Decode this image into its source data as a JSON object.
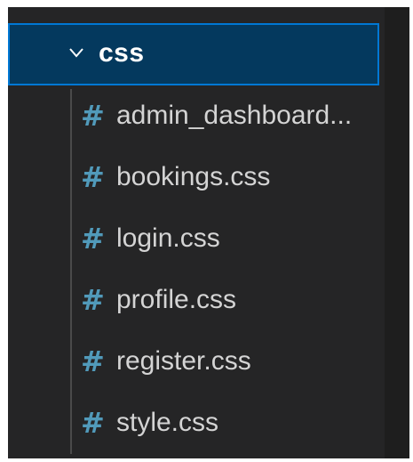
{
  "explorer": {
    "folder": {
      "name": "css",
      "expanded": true,
      "icon": "chevron-down-icon"
    },
    "files": [
      {
        "label": "admin_dashboard...",
        "icon": "css-hash-icon",
        "icon_glyph": "#"
      },
      {
        "label": "bookings.css",
        "icon": "css-hash-icon",
        "icon_glyph": "#"
      },
      {
        "label": "login.css",
        "icon": "css-hash-icon",
        "icon_glyph": "#"
      },
      {
        "label": "profile.css",
        "icon": "css-hash-icon",
        "icon_glyph": "#"
      },
      {
        "label": "register.css",
        "icon": "css-hash-icon",
        "icon_glyph": "#"
      },
      {
        "label": "style.css",
        "icon": "css-hash-icon",
        "icon_glyph": "#"
      }
    ],
    "colors": {
      "background": "#252526",
      "selected_row": "#04395e",
      "focus_border": "#0078d4",
      "css_icon": "#519aba",
      "file_text": "#d4d4d4"
    }
  }
}
